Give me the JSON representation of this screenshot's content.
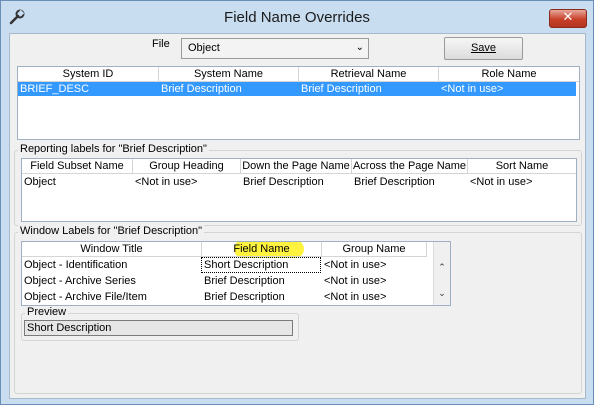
{
  "window": {
    "title": "Field Name Overrides",
    "close_glyph": "✕",
    "icon": "wrench-icon"
  },
  "toolbar": {
    "file_label": "File",
    "file_value": "Object",
    "save_label": "Save"
  },
  "fields_grid": {
    "columns": [
      "System ID",
      "System Name",
      "Retrieval Name",
      "Role Name"
    ],
    "rows": [
      [
        "BRIEF_DESC",
        "Brief Description",
        "Brief Description",
        "<Not in use>"
      ]
    ]
  },
  "reporting": {
    "title": "Reporting labels for \"Brief Description\"",
    "columns": [
      "Field Subset Name",
      "Group Heading",
      "Down the Page Name",
      "Across the Page Name",
      "Sort Name"
    ],
    "rows": [
      [
        "Object",
        "<Not in use>",
        "Brief Description",
        "Brief Description",
        "<Not in use>"
      ]
    ]
  },
  "window_labels": {
    "title": "Window Labels for \"Brief Description\"",
    "columns": [
      "Window Title",
      "Field Name",
      "Group Name"
    ],
    "rows": [
      [
        "Object - Identification",
        "Short Description",
        "<Not in use>"
      ],
      [
        "Object - Archive Series",
        "Brief Description",
        "<Not in use>"
      ],
      [
        "Object - Archive File/Item",
        "Brief Description",
        "<Not in use>"
      ]
    ],
    "highlight_color": "#fff22a"
  },
  "preview": {
    "label": "Preview",
    "value": "Short Description"
  },
  "colors": {
    "selection": "#3399ff",
    "frame": "#c9ddf0"
  }
}
